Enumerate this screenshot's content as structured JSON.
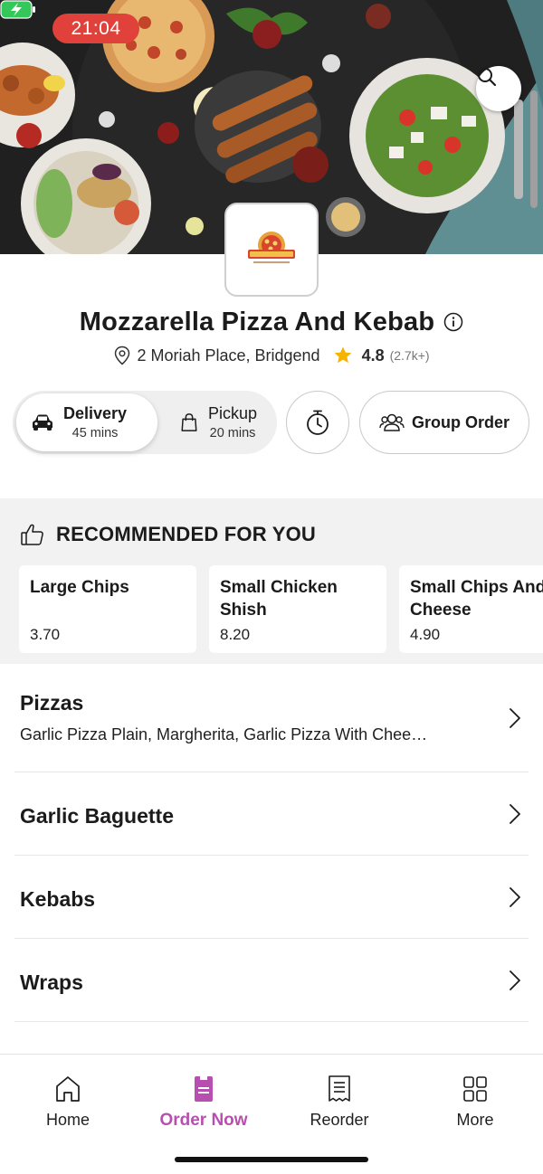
{
  "status_bar": {
    "time": "21:04"
  },
  "restaurant": {
    "name": "Mozzarella Pizza And Kebab",
    "address": "2 Moriah Place, Bridgend",
    "rating": "4.8",
    "rating_count": "(2.7k+)",
    "logo_text": "MOZZARELLA",
    "logo_tagline": "Pizza & Kebab Bridgend"
  },
  "order_modes": {
    "delivery": {
      "label": "Delivery",
      "time": "45 mins"
    },
    "pickup": {
      "label": "Pickup",
      "time": "20 mins"
    },
    "group_order_label": "Group Order"
  },
  "recommended": {
    "title": "RECOMMENDED FOR YOU",
    "items": [
      {
        "name": "Large Chips",
        "price": "3.70"
      },
      {
        "name": "Small Chicken Shish",
        "price": "8.20"
      },
      {
        "name": "Small Chips And Cheese",
        "price": "4.90"
      }
    ]
  },
  "categories": [
    {
      "title": "Pizzas",
      "subtitle": "Garlic Pizza Plain, Margherita, Garlic Pizza With Chee…"
    },
    {
      "title": "Garlic Baguette"
    },
    {
      "title": "Kebabs"
    },
    {
      "title": "Wraps"
    }
  ],
  "bottom_nav": [
    {
      "label": "Home",
      "icon": "home-icon"
    },
    {
      "label": "Order Now",
      "icon": "order-icon",
      "active": true
    },
    {
      "label": "Reorder",
      "icon": "receipt-icon"
    },
    {
      "label": "More",
      "icon": "grid-icon"
    }
  ],
  "colors": {
    "accent": "#b84fb0",
    "time_pill": "#e0413a",
    "rating_star": "#f5b400",
    "battery": "#34c759"
  }
}
